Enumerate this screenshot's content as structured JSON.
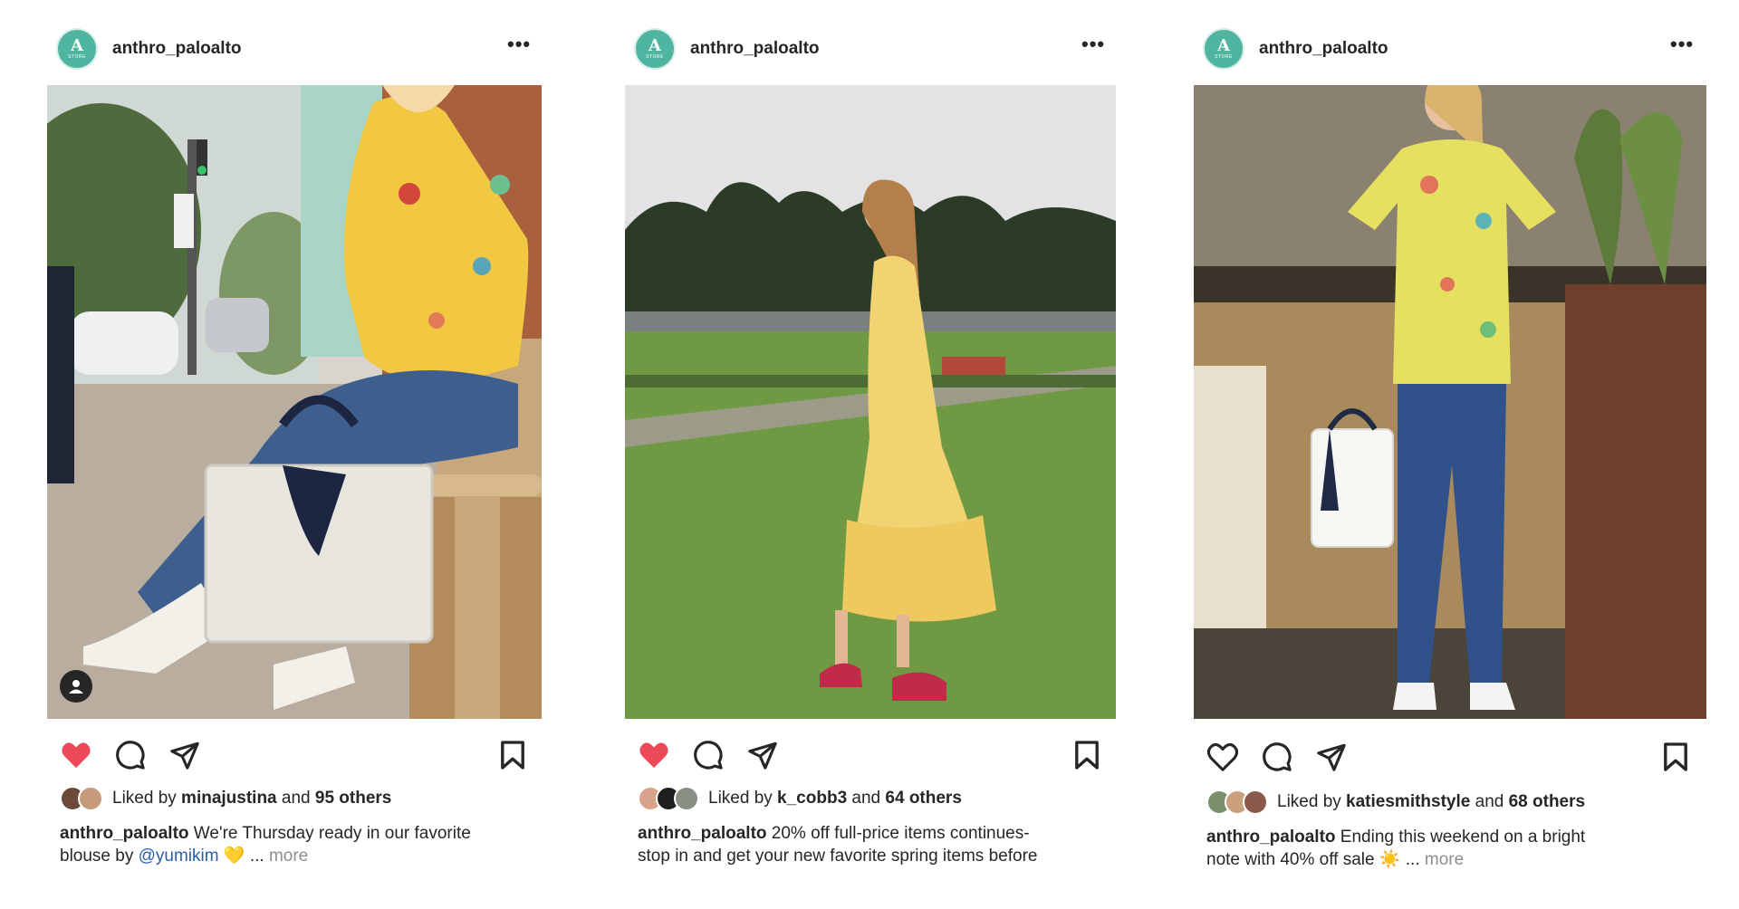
{
  "posts": [
    {
      "username": "anthro_paloalto",
      "avatar_letter": "A",
      "avatar_sub": "STORE",
      "liked": true,
      "liked_by_prefix": "Liked by ",
      "liked_by_user": "minajustina",
      "liked_by_joiner": " and ",
      "liked_by_others": "95 others",
      "caption_user": "anthro_paloalto",
      "caption_line1": "We're Thursday ready in our favorite",
      "caption_line2_prefix": "blouse by ",
      "caption_mention": "@yumikim",
      "caption_emoji": "💛",
      "caption_ellipsis": "...",
      "more": "more"
    },
    {
      "username": "anthro_paloalto",
      "avatar_letter": "A",
      "avatar_sub": "STORE",
      "liked": true,
      "liked_by_prefix": "Liked by ",
      "liked_by_user": "k_cobb3",
      "liked_by_joiner": " and ",
      "liked_by_others": "64 others",
      "caption_user": "anthro_paloalto",
      "caption_line1": "20% off full-price items continues-",
      "caption_line2": "stop in and get your new favorite spring items before"
    },
    {
      "username": "anthro_paloalto",
      "avatar_letter": "A",
      "avatar_sub": "STORE",
      "liked": false,
      "liked_by_prefix": "Liked by ",
      "liked_by_user": "katiesmithstyle",
      "liked_by_joiner": " and ",
      "liked_by_others": "68 others",
      "caption_user": "anthro_paloalto",
      "caption_line1": "Ending this weekend on a bright",
      "caption_line2_prefix": "note with 40% off sale ",
      "caption_emoji": "☀️",
      "caption_ellipsis": "...",
      "more": "more"
    }
  ],
  "colors": {
    "heart_liked": "#ed4956",
    "avatar_green": "#4fb5a0",
    "mention_blue": "#2a5fa8",
    "muted_gray": "#8e8e8e"
  },
  "icons": [
    "more-dots-icon",
    "heart-icon",
    "comment-icon",
    "share-icon",
    "bookmark-icon",
    "user-tag-icon"
  ]
}
